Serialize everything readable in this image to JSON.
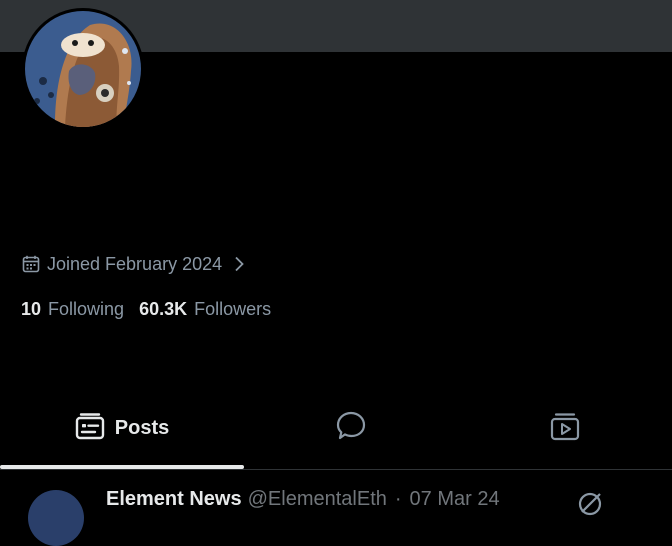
{
  "profile": {
    "joined": "Joined February 2024",
    "following_count": "10",
    "following_label": "Following",
    "followers_count": "60.3K",
    "followers_label": "Followers"
  },
  "tabs": [
    {
      "label": "Posts",
      "icon": "posts-icon",
      "selected": true
    },
    {
      "label": "",
      "icon": "replies-bubble-icon",
      "selected": false
    },
    {
      "label": "",
      "icon": "media-play-icon",
      "selected": false
    }
  ],
  "tweet_preview": {
    "name": "Element News",
    "handle": "@ElementalEth",
    "separator": "·",
    "date": "07 Mar 24"
  },
  "colors": {
    "background": "#000000",
    "banner": "#2f3336",
    "text": "#e7e9ea",
    "muted": "#8b98a5",
    "divider": "#2f3336"
  }
}
